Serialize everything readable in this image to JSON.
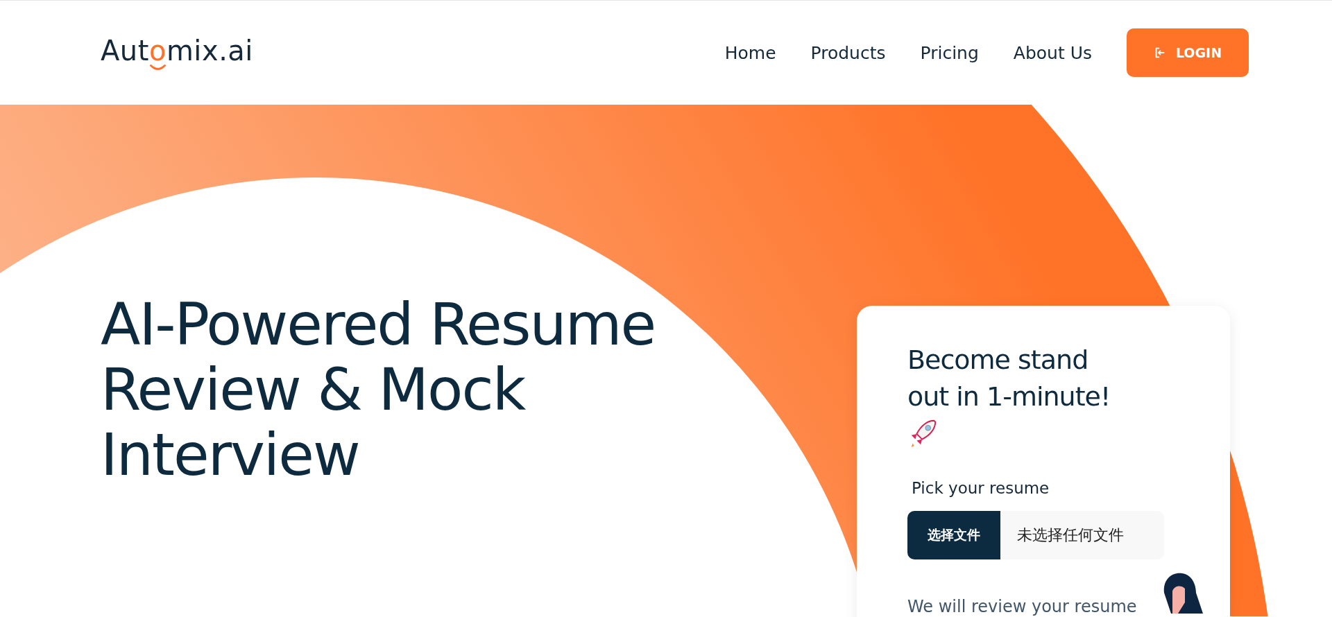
{
  "header": {
    "logo": [
      {
        "text": "Aut",
        "accent": false
      },
      {
        "text": "o",
        "accent": true
      },
      {
        "text": "mix.ai",
        "accent": false
      }
    ],
    "nav": [
      "Home",
      "Products",
      "Pricing",
      "About Us"
    ],
    "login_button": "LOGIN"
  },
  "hero": {
    "headline": "AI-Powered Resume Review & Mock Interview"
  },
  "card": {
    "title": "Become stand out in 1-minute!",
    "file_label": "Pick your resume",
    "file_input": {
      "button": "选择文件",
      "status": "未选择任何文件"
    },
    "description": "We will review your resume"
  }
}
